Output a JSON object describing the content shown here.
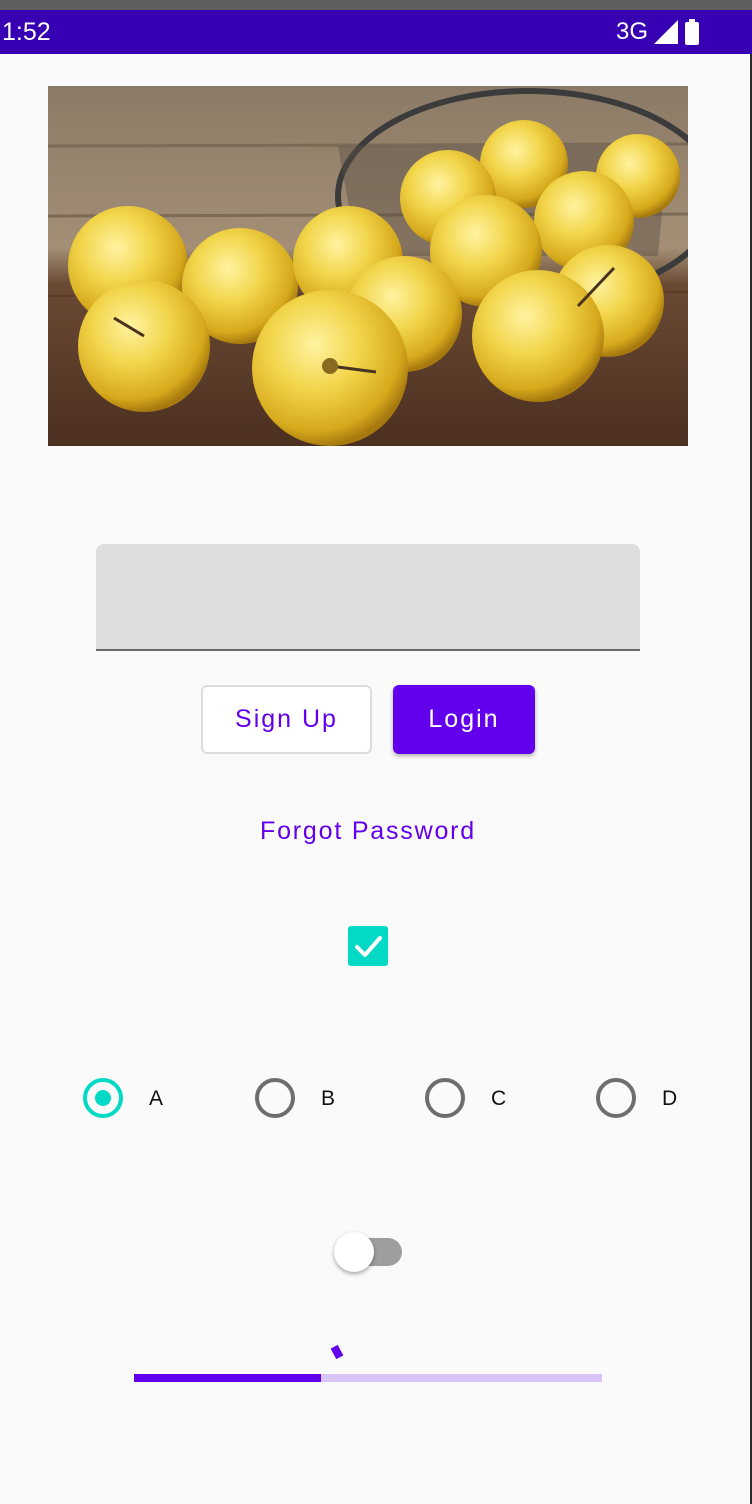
{
  "status_bar": {
    "time": "1:52",
    "network": "3G",
    "signal_icon": "signal-icon",
    "battery_icon": "battery-icon",
    "background_color": "#3700b3"
  },
  "hero_image": {
    "description_icon": "apples-photo"
  },
  "form": {
    "text_field_value": "",
    "signup_label": "Sign Up",
    "login_label": "Login",
    "forgot_password_label": "Forgot Password"
  },
  "checkbox": {
    "checked": true,
    "icon": "check-icon",
    "color": "#03dac5"
  },
  "radio_group": {
    "selected": "A",
    "options": [
      {
        "label": "A",
        "checked": true
      },
      {
        "label": "B",
        "checked": false
      },
      {
        "label": "C",
        "checked": false
      },
      {
        "label": "D",
        "checked": false
      }
    ]
  },
  "switch": {
    "on": false
  },
  "slider": {
    "value_fraction": 0.4
  },
  "colors": {
    "primary": "#6200ee",
    "primary_dark": "#3700b3",
    "accent": "#03dac5",
    "background": "#fafafa"
  }
}
